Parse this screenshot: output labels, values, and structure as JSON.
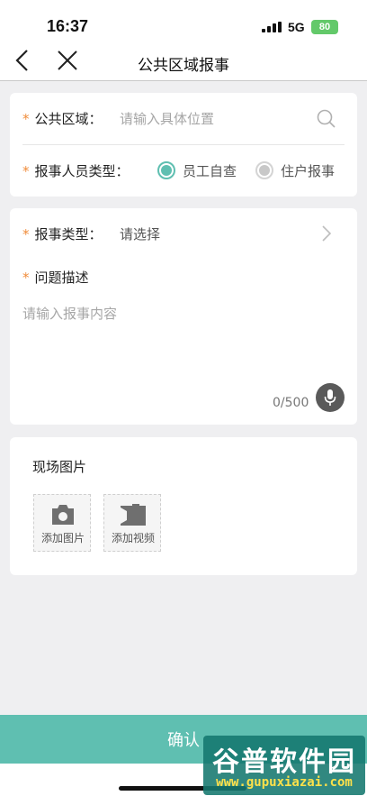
{
  "status_bar": {
    "time": "16:37",
    "network": "5G",
    "battery": "80"
  },
  "nav": {
    "title": "公共区域报事"
  },
  "form": {
    "area": {
      "label": "公共区域：",
      "placeholder": "请输入具体位置"
    },
    "reporter_type": {
      "label": "报事人员类型：",
      "options": [
        "员工自查",
        "住户报事"
      ],
      "selected": "员工自查"
    },
    "report_type": {
      "label": "报事类型：",
      "value": "请选择"
    },
    "description": {
      "label": "问题描述",
      "placeholder": "请输入报事内容",
      "counter": "0/500"
    }
  },
  "photos": {
    "title": "现场图片",
    "add_photo": "添加图片",
    "add_video": "添加视频"
  },
  "confirm_label": "确认",
  "watermark": {
    "main": "谷普软件园",
    "url": "www.gupuxiazai.com"
  },
  "colors": {
    "accent": "#5fbfb1",
    "required_star": "#f08c3a",
    "battery": "#63c96a"
  }
}
